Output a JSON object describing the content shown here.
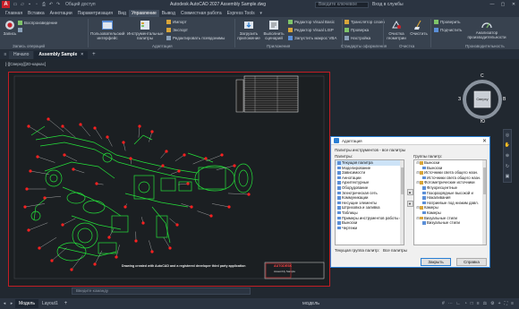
{
  "title_bar": {
    "app_icon_letter": "A",
    "share_label": "Общий доступ",
    "title": "Autodesk AutoCAD 2027   Assembly Sample.dwg",
    "search_placeholder": "Введите ключевое",
    "signin_label": "Вход в службы"
  },
  "ribbon_tabs": [
    "Главная",
    "Вставка",
    "Аннотации",
    "Параметризация",
    "Вид",
    "Управление",
    "Вывод",
    "Совместная работа",
    "Express Tools"
  ],
  "active_ribbon_tab": "Управление",
  "ribbon": {
    "record_label": "Запись",
    "playback_label": "Воспроизведение",
    "recorder_panel": "Запись операций",
    "ui_label": "Пользовательский интерфейс",
    "tool_palettes_label": "Инструментальные палитры",
    "import_label": "Импорт",
    "export_label": "Экспорт",
    "edit_aliases_label": "Редактировать псевдонимы",
    "customization_panel": "Адаптация",
    "load_app_label": "Загрузить приложение",
    "run_script_label": "Выполнить сценарий",
    "vb_editor_label": "Редактор Visual Basic",
    "vlisp_editor_label": "Редактор Visual LISP",
    "run_vba_label": "Запустить макрос VBA",
    "applications_panel": "Приложения",
    "layer_translator_label": "Транслятор слоев",
    "check_label": "Проверка",
    "configure_label": "Настройка",
    "cad_standards_panel": "Стандарты оформления",
    "purge_geometry_label": "Очистка геометрии",
    "cleanup_label": "Очистить",
    "cleanup_panel": "Очистка",
    "audit_label": "Проверить",
    "recover_label": "Подчистить",
    "performance_analyzer_label": "Анализатор производительности",
    "performance_panel": "Производительность"
  },
  "doc_tabs": [
    {
      "label": "Начало"
    },
    {
      "label": "Assembly Sample",
      "close": "×"
    }
  ],
  "new_tab_plus": "+",
  "viewport_label": "[-][Сверху][2D-каркас]",
  "viewcube": {
    "top": "С",
    "bottom": "Ю",
    "left": "З",
    "right": "В",
    "face": "Сверху",
    "wcs": "МСК"
  },
  "drawing_caption": "Drawing created with AutoCAD and a registered developer third party application",
  "titleblock_name": "AUTODESK",
  "titleblock_sub": "Assembly Sample",
  "command_placeholder": "Введите команду",
  "dialog": {
    "title": "Адаптация",
    "subtitle": "Палитры инструментов - все палитры",
    "palettes_label": "Палитры:",
    "groups_label": "Группы палитр:",
    "palettes": [
      "Текущая палитра",
      "Моделирование",
      "Зависимости",
      "Аннотации",
      "Архитектурные",
      "Оборудование",
      "Электрическая сеть",
      "Коммуникации",
      "Несущие элементы",
      "Штриховка и заливка",
      "Таблицы",
      "Примеры инструментов работы с",
      "Выноски",
      "Чертежи"
    ],
    "groups": [
      {
        "label": "Выноски",
        "level": 0
      },
      {
        "label": "Выноски",
        "level": 1
      },
      {
        "label": "Источники света общего назн.",
        "level": 0
      },
      {
        "label": "Источники света общего назн.",
        "level": 1
      },
      {
        "label": "Фотометрические источники",
        "level": 0
      },
      {
        "label": "Флуоресцентные",
        "level": 1
      },
      {
        "label": "Газоразрядные высокой и",
        "level": 1
      },
      {
        "label": "Накаливания",
        "level": 1
      },
      {
        "label": "Натриевые под низким давл.",
        "level": 1
      },
      {
        "label": "Камеры",
        "level": 0
      },
      {
        "label": "Камеры",
        "level": 1
      },
      {
        "label": "Визуальные стили",
        "level": 0
      },
      {
        "label": "Визуальные стили",
        "level": 1
      }
    ],
    "current_group_label": "Текущая группа палитр:",
    "current_group_value": "Все палитры",
    "close_button": "Закрыть",
    "help_button": "Справка"
  },
  "status_bar": {
    "tabs": [
      "Модель",
      "Layout1"
    ],
    "plus": "+",
    "model_label": "МОДЕЛЬ"
  }
}
